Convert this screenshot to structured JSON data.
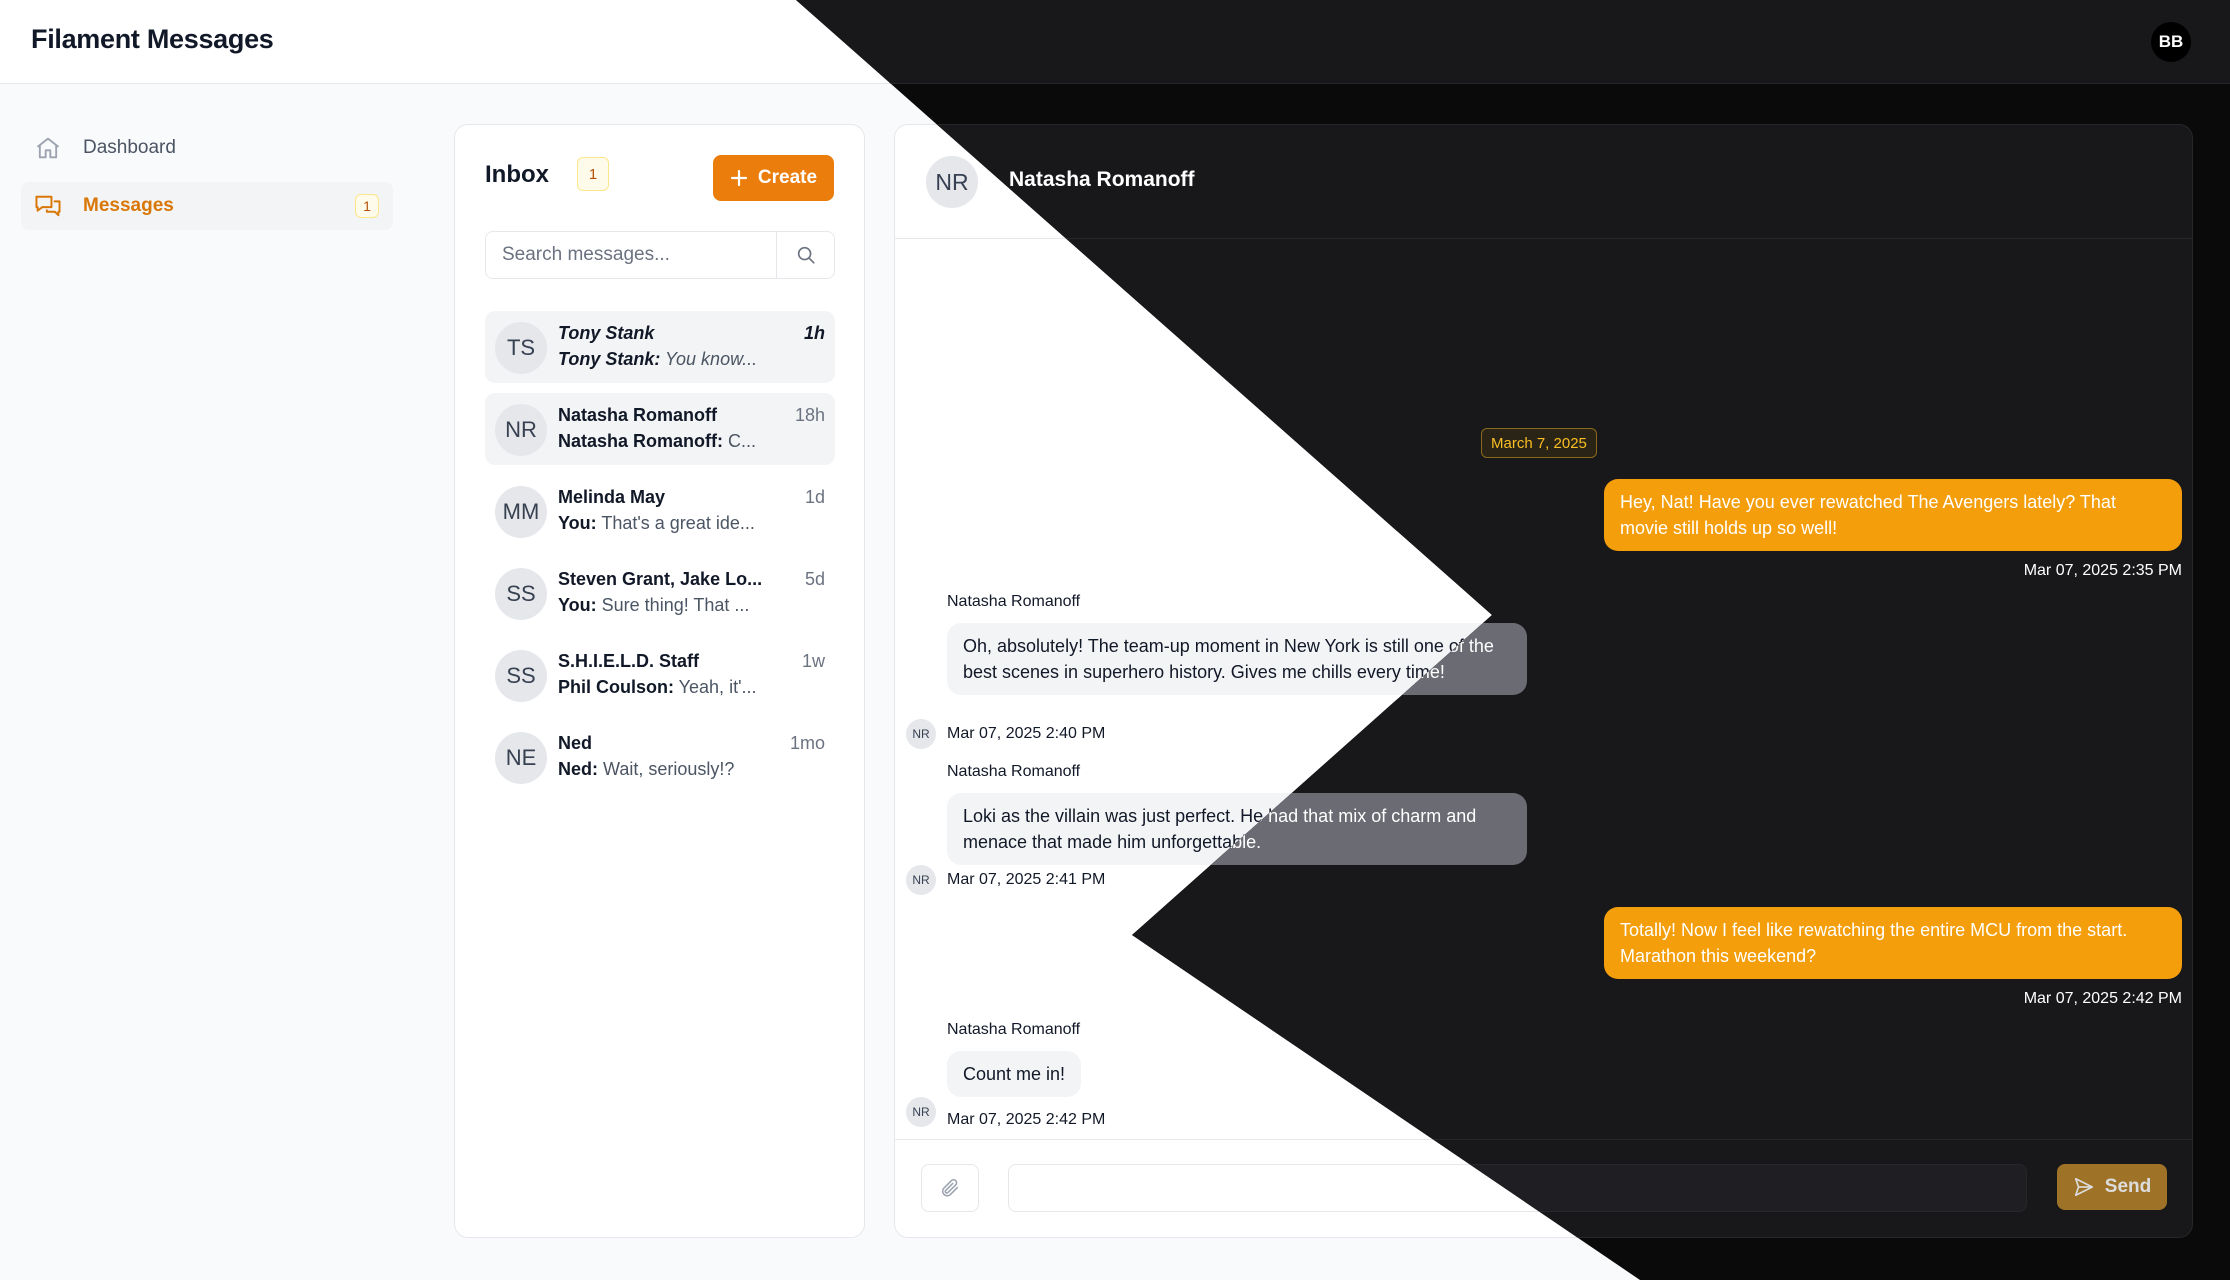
{
  "app": {
    "title": "Filament Messages",
    "user_initials": "BB"
  },
  "sidebar": {
    "items": [
      {
        "label": "Dashboard",
        "icon": "home-icon"
      },
      {
        "label": "Messages",
        "icon": "chat-bubbles-icon",
        "badge": "1",
        "active": true
      }
    ]
  },
  "inbox": {
    "title": "Inbox",
    "badge": "1",
    "create_label": "Create",
    "search_placeholder": "Search messages...",
    "conversations": [
      {
        "initials": "TS",
        "name": "Tony Stank",
        "time": "1h",
        "sender": "Tony Stank:",
        "preview": " You know...",
        "unread": true,
        "selected": true
      },
      {
        "initials": "NR",
        "name": "Natasha Romanoff",
        "time": "18h",
        "sender": "Natasha Romanoff:",
        "preview": " C...",
        "selected": true
      },
      {
        "initials": "MM",
        "name": "Melinda May",
        "time": "1d",
        "sender": "You:",
        "preview": " That's a great ide..."
      },
      {
        "initials": "SS",
        "name": "Steven Grant, Jake Lo...",
        "time": "5d",
        "sender": "You:",
        "preview": " Sure thing! That ..."
      },
      {
        "initials": "SS",
        "name": "S.H.I.E.L.D. Staff",
        "time": "1w",
        "sender": "Phil Coulson:",
        "preview": " Yeah, it'..."
      },
      {
        "initials": "NE",
        "name": "Ned",
        "time": "1mo",
        "sender": "Ned:",
        "preview": " Wait, seriously!?"
      }
    ]
  },
  "chat": {
    "initials": "NR",
    "name": "Natasha Romanoff",
    "date_divider": "March 7, 2025",
    "messages": [
      {
        "dir": "out",
        "text": "Hey, Nat! Have you ever rewatched The Avengers lately? That movie still holds up so well!",
        "time": "Mar 07, 2025 2:35 PM"
      },
      {
        "dir": "in",
        "sender": "Natasha Romanoff",
        "avatar": "NR",
        "text": "Oh, absolutely! The team-up moment in New York is still one of the best scenes in superhero history. Gives me chills every time!",
        "time": "Mar 07, 2025 2:40 PM"
      },
      {
        "dir": "in",
        "sender": "Natasha Romanoff",
        "avatar": "NR",
        "text": "Loki as the villain was just perfect. He had that mix of charm and menace that made him unforgettable.",
        "time": "Mar 07, 2025 2:41 PM"
      },
      {
        "dir": "out",
        "text": "Totally! Now I feel like rewatching the entire MCU from the start. Marathon this weekend?",
        "time": "Mar 07, 2025 2:42 PM"
      },
      {
        "dir": "in",
        "sender": "Natasha Romanoff",
        "avatar": "NR",
        "text": "Count me in!",
        "time": "Mar 07, 2025 2:42 PM"
      }
    ],
    "composer": {
      "value": "",
      "send_label": "Send",
      "attach_icon": "paperclip-icon",
      "send_icon": "paper-plane-icon"
    }
  },
  "colors": {
    "accent": "#f59e0b",
    "create": "#ea7d0c",
    "dark_bg": "#18181b"
  }
}
